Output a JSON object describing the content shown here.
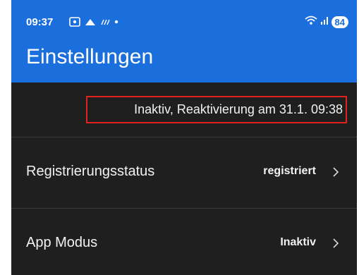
{
  "status_bar": {
    "time": "09:37",
    "battery": "84",
    "icons": [
      "screenshot-icon",
      "cloud-icon",
      "weather-icon",
      "dot-icon",
      "wifi-icon",
      "signal-icon"
    ]
  },
  "header": {
    "title": "Einstellungen"
  },
  "notice": {
    "text": "Inaktiv, Reaktivierung am 31.1. 09:38"
  },
  "settings": [
    {
      "label": "Registrierungsstatus",
      "value": "registriert"
    },
    {
      "label": "App Modus",
      "value": "Inaktiv"
    }
  ],
  "colors": {
    "header": "#1a6fdc",
    "background": "#1f1f1f",
    "highlight": "#e0231e",
    "text": "#f2f2f2"
  }
}
